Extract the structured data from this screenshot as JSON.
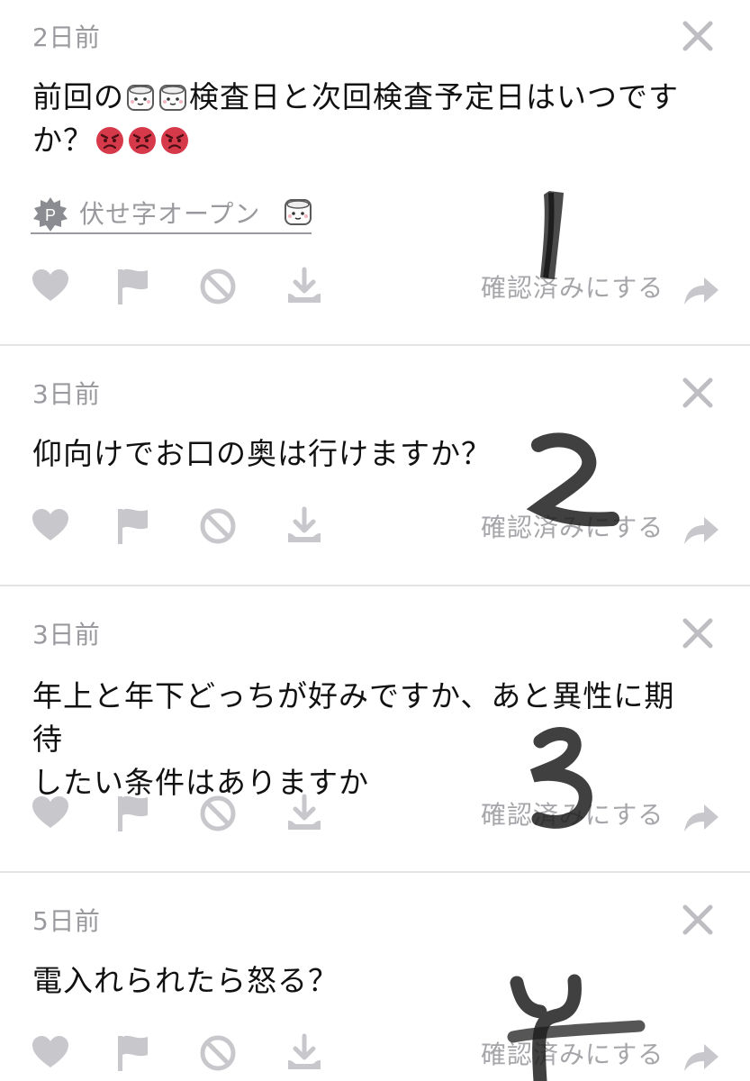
{
  "colors": {
    "icon_gray": "#c8c8cc",
    "text_gray": "#9a9a9e",
    "divider": "#e4e4e6",
    "angry_red": "#d63a4a"
  },
  "questions": [
    {
      "time": "2日前",
      "message_lines": [
        "前回の",
        "検査日と次回検査予定日はいつです",
        "か？"
      ],
      "emoji": [
        "marshmallow-icon",
        "marshmallow-icon",
        "angry-face-icon",
        "angry-face-icon",
        "angry-face-icon"
      ],
      "reveal_label": "伏せ字オープン",
      "reveal_badge": "P",
      "confirm_label": "確認済みにする"
    },
    {
      "time": "3日前",
      "message": "仰向けでお口の奥は行けますか？",
      "confirm_label": "確認済みにする"
    },
    {
      "time": "3日前",
      "message_lines": [
        "年上と年下どっちが好みですか、あと異性に期待",
        "したい条件はありますか"
      ],
      "confirm_label": "確認済みにする"
    },
    {
      "time": "5日前",
      "message": "電入れられたら怒る？",
      "confirm_label": "確認済みにする"
    }
  ],
  "action_icons": [
    "heart-icon",
    "flag-icon",
    "block-icon",
    "download-icon",
    "share-arrow-icon"
  ]
}
